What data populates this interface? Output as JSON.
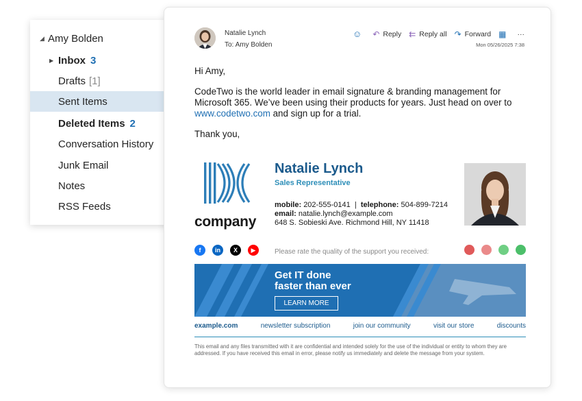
{
  "folders": {
    "account": "Amy Bolden",
    "items": [
      {
        "label": "Inbox",
        "count": "3"
      },
      {
        "label": "Drafts",
        "count": "[1]"
      },
      {
        "label": "Sent Items"
      },
      {
        "label": "Deleted Items",
        "count": "2"
      },
      {
        "label": "Conversation History"
      },
      {
        "label": "Junk Email"
      },
      {
        "label": "Notes"
      },
      {
        "label": "RSS Feeds"
      }
    ],
    "selected": "Sent Items"
  },
  "message": {
    "sender": "Natalie Lynch",
    "to": "To: Amy Bolden",
    "date": "Mon 05/26/2025 7:38",
    "actions": {
      "reply": "Reply",
      "reply_all": "Reply all",
      "forward": "Forward"
    },
    "greeting": "Hi Amy,",
    "paragraph_1": "CodeTwo is the world leader in email signature & branding management for Microsoft 365. We’ve been using their products for years. Just head on over to",
    "link": "www.codetwo.com",
    "paragraph_1_end": " and sign up for a trial.",
    "closing": "Thank you,"
  },
  "signature": {
    "company": "company",
    "name": "Natalie Lynch",
    "role": "Sales Representative",
    "mobile_label": "mobile:",
    "mobile": "202-555-0141",
    "sep": "|",
    "telephone_label": "telephone:",
    "telephone": "504-899-7214",
    "email_label": "email:",
    "email": "natalie.lynch@example.com",
    "address": "648 S. Sobieski Ave. Richmond Hill, NY 11418",
    "rate_text": "Please rate the quality of the support you received:",
    "banner_line1": "Get IT done",
    "banner_line2": "faster than ever",
    "banner_button": "LEARN MORE",
    "links": [
      "example.com",
      "newsletter subscription",
      "join our community",
      "visit our store",
      "discounts"
    ],
    "disclaimer": "This email and any files transmitted with it are confidential and intended solely for the use of the individual or entity to whom they are addressed. If you have received this email in error, please notify us immediately and delete the message from your system."
  },
  "colors": {
    "accent": "#1f6fb3",
    "selected_folder": "#d9e6f1",
    "signature_name": "#1b5a8c",
    "facebook": "#1877f2",
    "linkedin": "#0a66c2",
    "x": "#000000",
    "youtube": "#ff0000",
    "rate_bad": "#e05a5a",
    "rate_good": "#4cbf6a"
  }
}
